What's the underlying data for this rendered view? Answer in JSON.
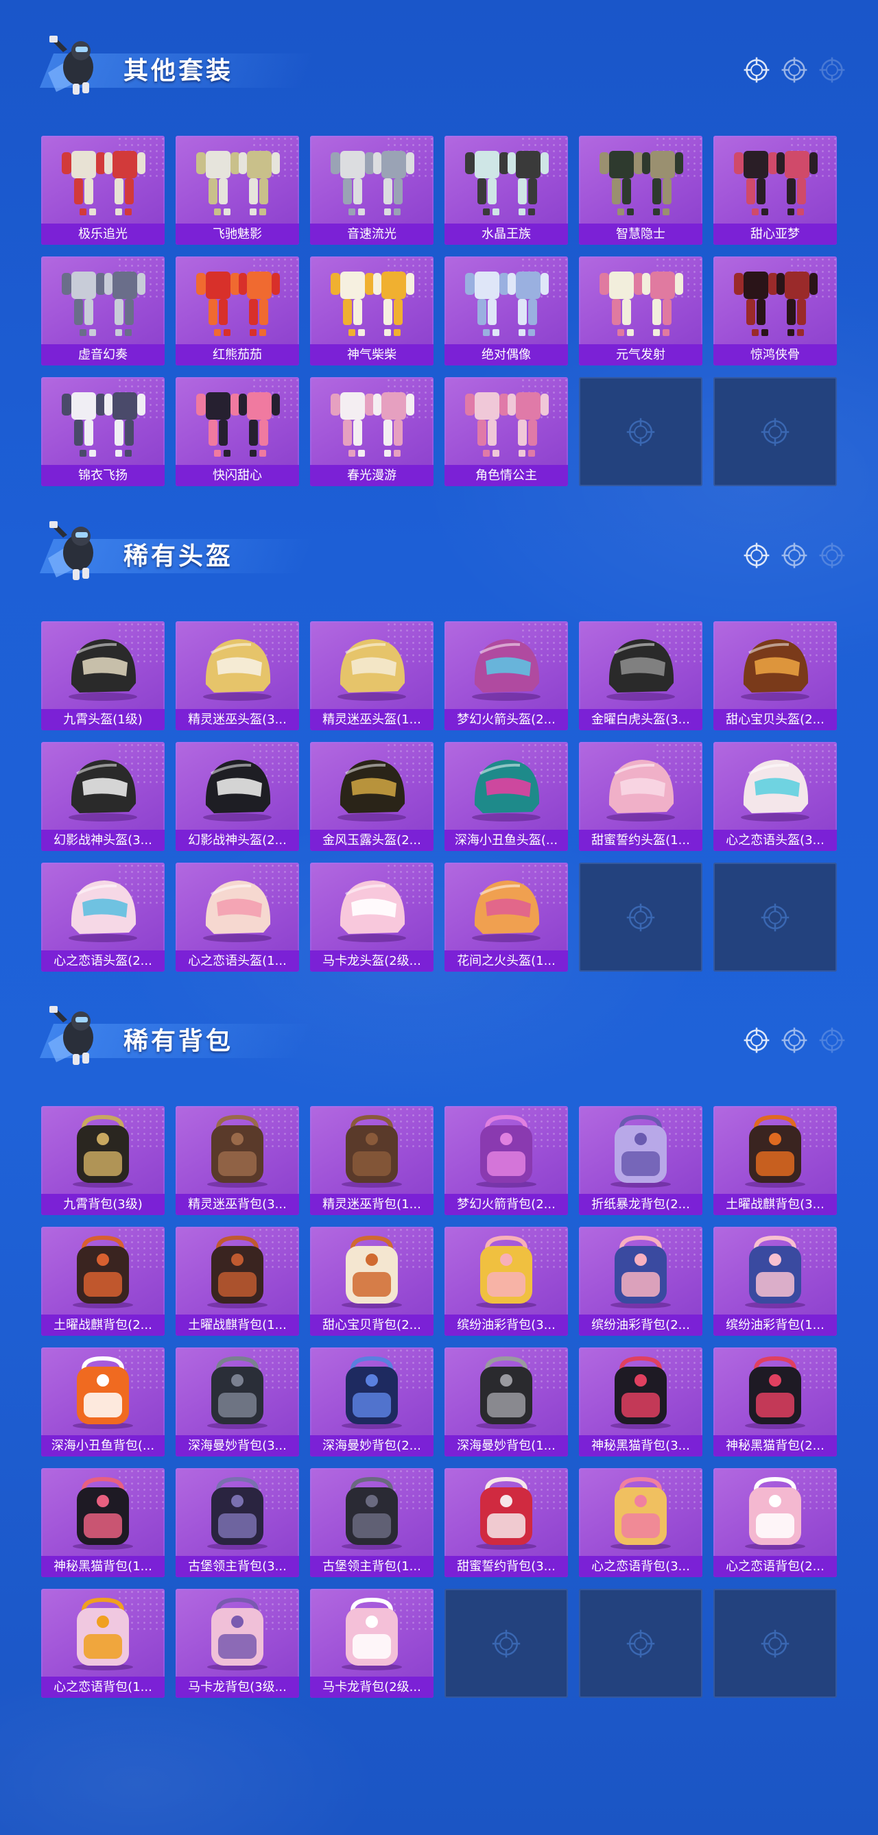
{
  "colors": {
    "accent": "#7b21d6",
    "card": "#9c4fd6",
    "empty_slot": "#23427e",
    "background": "#1d5fd6"
  },
  "sections": [
    {
      "title": "其他套装",
      "item_type": "suit",
      "items": [
        "极乐追光",
        "飞驰魅影",
        "音速流光",
        "水晶王族",
        "智慧隐士",
        "甜心亚梦",
        "虚音幻奏",
        "红熊茄茄",
        "神气柴柴",
        "绝对偶像",
        "元气发射",
        "惊鸿侠骨",
        "锦衣飞扬",
        "快闪甜心",
        "春光漫游",
        "角色情公主"
      ],
      "empty_slots": 2
    },
    {
      "title": "稀有头盔",
      "item_type": "helmet",
      "items": [
        "九霄头盔(1级)",
        "精灵迷巫头盔(3...",
        "精灵迷巫头盔(1...",
        "梦幻火箭头盔(2...",
        "金曜白虎头盔(3...",
        "甜心宝贝头盔(2...",
        "幻影战神头盔(3...",
        "幻影战神头盔(2...",
        "金风玉露头盔(2...",
        "深海小丑鱼头盔(...",
        "甜蜜誓约头盔(1...",
        "心之恋语头盔(3...",
        "心之恋语头盔(2...",
        "心之恋语头盔(1...",
        "马卡龙头盔(2级...",
        "花间之火头盔(1..."
      ],
      "empty_slots": 2
    },
    {
      "title": "稀有背包",
      "item_type": "backpack",
      "items": [
        "九霄背包(3级)",
        "精灵迷巫背包(3...",
        "精灵迷巫背包(1...",
        "梦幻火箭背包(2...",
        "折纸暴龙背包(2...",
        "土曜战麒背包(3...",
        "土曜战麒背包(2...",
        "土曜战麒背包(1...",
        "甜心宝贝背包(2...",
        "缤纷油彩背包(3...",
        "缤纷油彩背包(2...",
        "缤纷油彩背包(1...",
        "深海小丑鱼背包(...",
        "深海曼妙背包(3...",
        "深海曼妙背包(2...",
        "深海曼妙背包(1...",
        "神秘黑猫背包(3...",
        "神秘黑猫背包(2...",
        "神秘黑猫背包(1...",
        "古堡领主背包(3...",
        "古堡领主背包(1...",
        "甜蜜誓约背包(3...",
        "心之恋语背包(3...",
        "心之恋语背包(2...",
        "心之恋语背包(1...",
        "马卡龙背包(3级...",
        "马卡龙背包(2级..."
      ],
      "empty_slots": 3
    }
  ],
  "icons": {
    "slot_placeholder": "crosshair-icon",
    "header_deco": "target-icon"
  }
}
